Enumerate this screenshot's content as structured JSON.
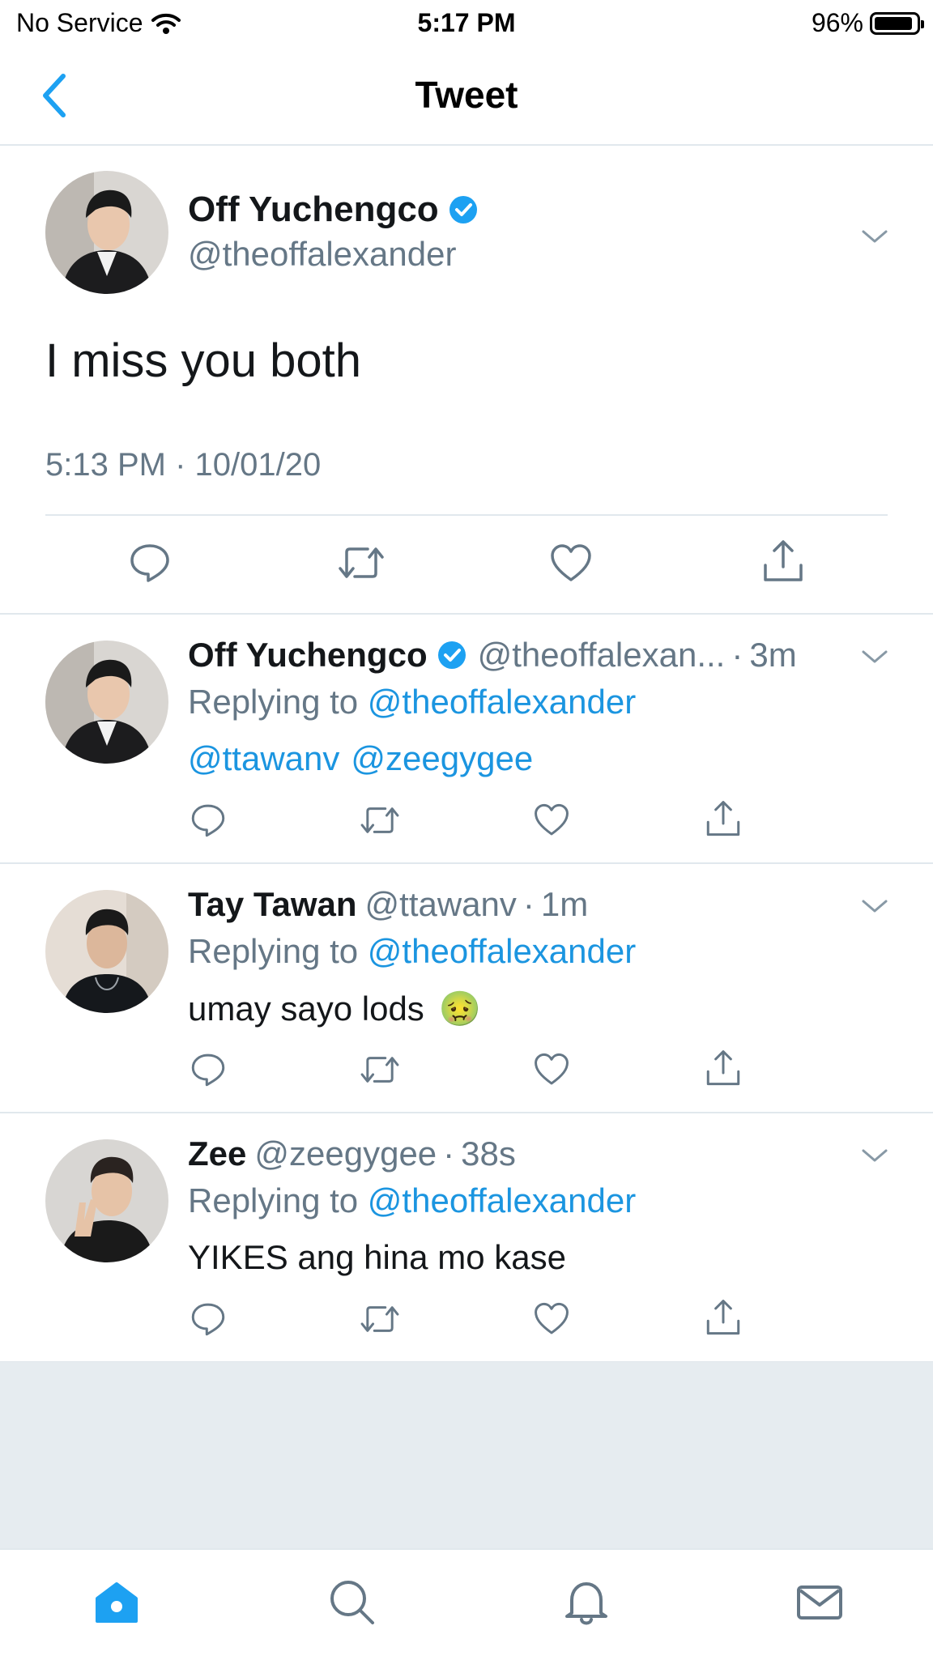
{
  "status_bar": {
    "carrier": "No Service",
    "time": "5:17 PM",
    "battery": "96%"
  },
  "nav": {
    "title": "Tweet"
  },
  "main_tweet": {
    "name": "Off Yuchengco",
    "handle": "@theoffalexander",
    "text": "I miss you both",
    "timestamp": "5:13 PM · 10/01/20"
  },
  "replies": [
    {
      "name": "Off Yuchengco",
      "handle": "@theoffalexan...",
      "age": "3m",
      "replying_prefix": "Replying to",
      "replying_to": "@theoffalexander",
      "mention_1": "@ttawanv",
      "mention_2": "@zeegygee"
    },
    {
      "name": "Tay Tawan",
      "handle": "@ttawanv",
      "age": "1m",
      "replying_prefix": "Replying to",
      "replying_to": "@theoffalexander",
      "text": "umay sayo lods",
      "emoji": "🤢"
    },
    {
      "name": "Zee",
      "handle": "@zeegygee",
      "age": "38s",
      "replying_prefix": "Replying to",
      "replying_to": "@theoffalexander",
      "text": "YIKES ang hina mo kase"
    }
  ],
  "colors": {
    "accent": "#1DA1F2",
    "link": "#1B95E0",
    "secondary_text": "#657786",
    "divider": "#E1E8ED",
    "filler": "#E6ECF0"
  }
}
